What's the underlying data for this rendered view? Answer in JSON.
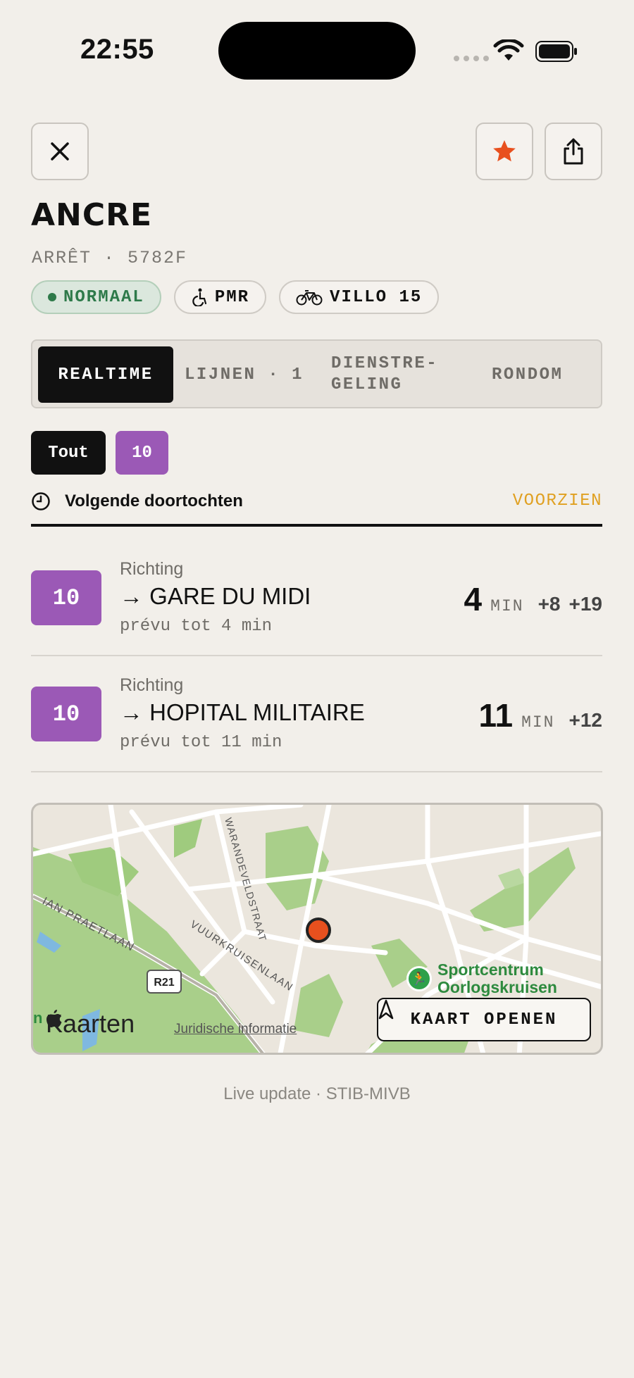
{
  "status_bar": {
    "time": "22:55"
  },
  "header": {
    "title": "ANCRE",
    "subtitle": "ARRÊT · 5782F"
  },
  "chips": [
    {
      "label": "NORMAAL"
    },
    {
      "label": "PMR"
    },
    {
      "label": "VILLO 15"
    }
  ],
  "tabs": [
    {
      "label": "REALTIME"
    },
    {
      "label": "LIJNEN · 1"
    },
    {
      "label": "DIENSTRE-GELING"
    },
    {
      "label": "RONDOM"
    }
  ],
  "filters": [
    {
      "label": "Tout"
    },
    {
      "label": "10"
    }
  ],
  "section": {
    "title": "Volgende doortochten",
    "link": "VOORZIEN"
  },
  "departures": [
    {
      "line": "10",
      "dir_label": "Richting",
      "destination": "→ GARE DU MIDI",
      "note": "prévu tot 4 min",
      "time": "4",
      "unit": "MIN",
      "next": [
        "+8",
        "+19"
      ]
    },
    {
      "line": "10",
      "dir_label": "Richting",
      "destination": "→ HOPITAL MILITAIRE",
      "note": "prévu tot 11 min",
      "time": "11",
      "unit": "MIN",
      "next": [
        "+12"
      ]
    }
  ],
  "map": {
    "logo": "Kaarten",
    "legal": "Juridische informatie",
    "button": "KAART OPENEN",
    "poi_line1": "Sportcentrum",
    "poi_line2": "Oorlogskruisen",
    "road_badge": "R21",
    "street1": "WARANDEVELDSTRAAT",
    "street2": "VUURKRUISENLAAN",
    "street3": "IAN PRAETLAAN",
    "edge_letter": "n"
  },
  "footer": {
    "text": "Live update · STIB-MIVB"
  },
  "colors": {
    "accent_orange": "#e0a021",
    "line_10": "#9b59b6",
    "status_green": "#2e7a4a",
    "favorite": "#e8501e"
  }
}
